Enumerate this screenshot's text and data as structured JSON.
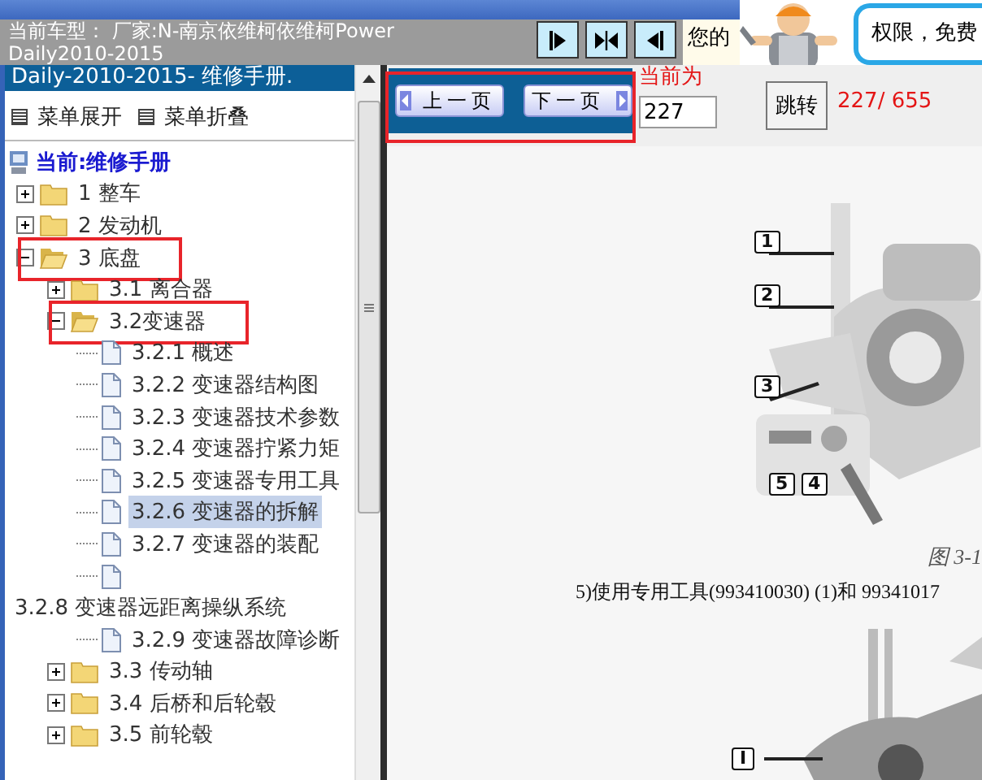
{
  "header": {
    "car_info": "当前车型： 厂家:N-南京依维柯依维柯Power Daily2010-2015",
    "notice": "您的",
    "bubble": "权限，免费"
  },
  "sidebar": {
    "title": "Daily-2010-2015- 维修手册.",
    "menu_links": [
      "菜单展开",
      "菜单折叠"
    ],
    "tree": {
      "root": "当前:维修手册",
      "items": [
        {
          "label": "1 整车",
          "kind": "folder",
          "expanded": false,
          "selected": false,
          "highlighted": false
        },
        {
          "label": "2 发动机",
          "kind": "folder",
          "expanded": false,
          "selected": false,
          "highlighted": false
        },
        {
          "label": "3 底盘",
          "kind": "folder",
          "expanded": true,
          "selected": false,
          "highlighted": true,
          "children": [
            {
              "label": "3.1 离合器",
              "kind": "folder",
              "expanded": false,
              "selected": false,
              "highlighted": false
            },
            {
              "label": "3.2变速器",
              "kind": "folder",
              "expanded": true,
              "selected": false,
              "highlighted": true,
              "children": [
                {
                  "label": "3.2.1 概述",
                  "kind": "page",
                  "selected": false,
                  "wrap": false
                },
                {
                  "label": "3.2.2 变速器结构图",
                  "kind": "page",
                  "selected": false,
                  "wrap": false
                },
                {
                  "label": "3.2.3 变速器技术参数",
                  "kind": "page",
                  "selected": false,
                  "wrap": false
                },
                {
                  "label": "3.2.4 变速器拧紧力矩",
                  "kind": "page",
                  "selected": false,
                  "wrap": false
                },
                {
                  "label": "3.2.5 变速器专用工具",
                  "kind": "page",
                  "selected": false,
                  "wrap": false
                },
                {
                  "label": "3.2.6 变速器的拆解",
                  "kind": "page",
                  "selected": true,
                  "wrap": false
                },
                {
                  "label": "3.2.7 变速器的装配",
                  "kind": "page",
                  "selected": false,
                  "wrap": false
                },
                {
                  "label": "3.2.8 变速器远距离操纵系统",
                  "kind": "page",
                  "selected": false,
                  "wrap": true
                },
                {
                  "label": "3.2.9 变速器故障诊断",
                  "kind": "page",
                  "selected": false,
                  "wrap": false
                }
              ]
            },
            {
              "label": "3.3 传动轴",
              "kind": "folder",
              "expanded": false,
              "selected": false,
              "highlighted": false
            },
            {
              "label": "3.4 后桥和后轮毂",
              "kind": "folder",
              "expanded": false,
              "selected": false,
              "highlighted": false
            },
            {
              "label": "3.5 前轮毂",
              "kind": "folder",
              "expanded": false,
              "selected": false,
              "highlighted": false
            }
          ]
        }
      ]
    }
  },
  "pager": {
    "highlighted": true,
    "prev": "上一页",
    "next": "下一页",
    "current_label": "当前为",
    "page_input": "227",
    "go": "跳转",
    "count": "227/ 655"
  },
  "document": {
    "figure_callouts": [
      "1",
      "2",
      "3",
      "5",
      "4"
    ],
    "caption": "图 3-1",
    "text": "5)使用专用工具(993410030) (1)和 99341017",
    "figure2_callouts": [
      "I"
    ]
  }
}
